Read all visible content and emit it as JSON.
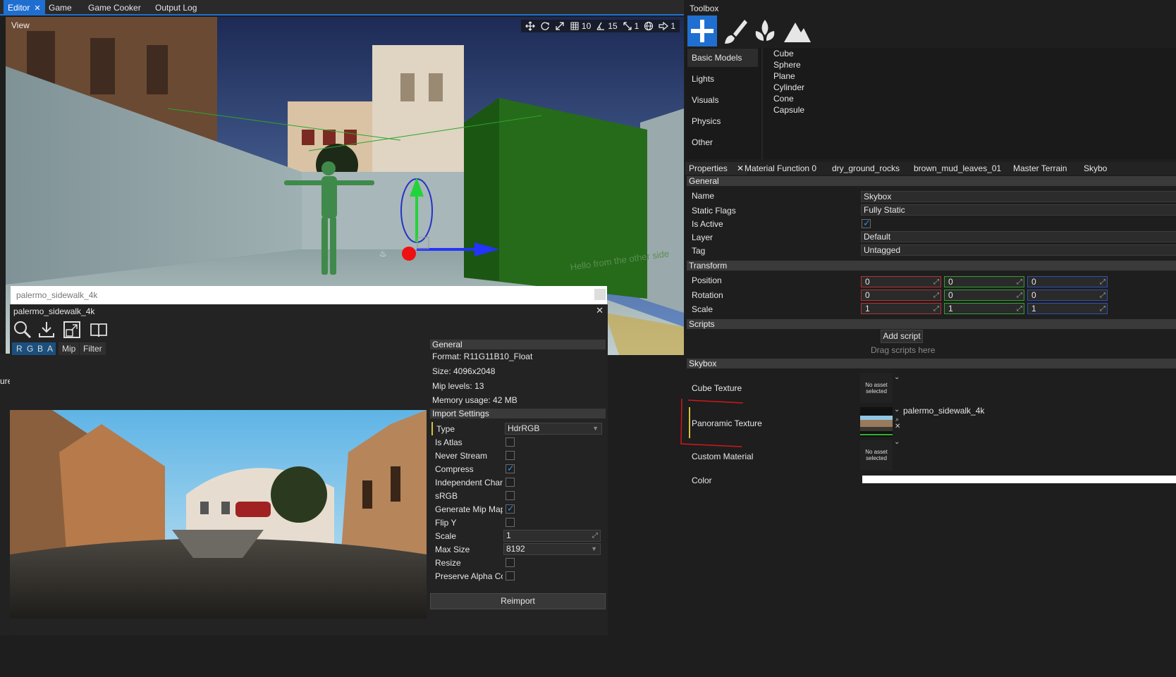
{
  "top_tabs": [
    {
      "label": "Editor",
      "close": "✕"
    },
    {
      "label": "Game"
    },
    {
      "label": "Game Cooker"
    },
    {
      "label": "Output Log"
    }
  ],
  "viewport": {
    "view_label": "View",
    "grid_snap": "10",
    "rotation_snap": "15",
    "scale_snap": "1",
    "translate_snap": "1",
    "scene_text": "Hello from the other side"
  },
  "texture_window": {
    "tab_title": "palermo_sidewalk_4k",
    "title": "palermo_sidewalk_4k",
    "close": "✕",
    "channels": [
      "R",
      "G",
      "B",
      "A"
    ],
    "mip_label": "Mip",
    "filter_label": "Filter",
    "general_header": "General",
    "format": "Format: R11G11B10_Float",
    "size": "Size: 4096x2048",
    "mip_levels": "Mip levels: 13",
    "memory": "Memory usage: 42 MB",
    "import_header": "Import Settings",
    "type_label": "Type",
    "type_value": "HdrRGB",
    "is_atlas": "Is Atlas",
    "never_stream": "Never Stream",
    "compress": "Compress",
    "independent_chan": "Independent Chan",
    "srgb": "sRGB",
    "generate_mip": "Generate Mip Map",
    "flip_y": "Flip Y",
    "scale_label": "Scale",
    "scale_value": "1",
    "max_size_label": "Max Size",
    "max_size_value": "8192",
    "resize": "Resize",
    "preserve_alpha": "Preserve Alpha Co",
    "reimport": "Reimport"
  },
  "left_fragment": "ure",
  "toolbox": {
    "title": "Toolbox",
    "categories": [
      "Basic Models",
      "Lights",
      "Visuals",
      "Physics",
      "Other"
    ],
    "items": [
      "Cube",
      "Sphere",
      "Plane",
      "Cylinder",
      "Cone",
      "Capsule"
    ]
  },
  "props_tabs": [
    "Properties",
    "Material Function 0",
    "dry_ground_rocks",
    "brown_mud_leaves_01",
    "Master Terrain",
    "Skybo"
  ],
  "props_close": "✕",
  "properties": {
    "general_header": "General",
    "name_label": "Name",
    "name_value": "Skybox",
    "static_label": "Static Flags",
    "static_value": "Fully Static",
    "active_label": "Is Active",
    "layer_label": "Layer",
    "layer_value": "Default",
    "tag_label": "Tag",
    "tag_value": "Untagged",
    "transform_header": "Transform",
    "position_label": "Position",
    "position": [
      "0",
      "0",
      "0"
    ],
    "rotation_label": "Rotation",
    "rotation": [
      "0",
      "0",
      "0"
    ],
    "scale_label": "Scale",
    "scale": [
      "1",
      "1",
      "1"
    ],
    "scripts_header": "Scripts",
    "add_script": "Add script",
    "drag_scripts": "Drag scripts here",
    "skybox_header": "Skybox",
    "cube_texture": "Cube Texture",
    "panoramic_texture": "Panoramic Texture",
    "panoramic_value": "palermo_sidewalk_4k",
    "custom_material": "Custom Material",
    "color_label": "Color",
    "no_asset_1": "No asset",
    "no_asset_2": "selected"
  }
}
